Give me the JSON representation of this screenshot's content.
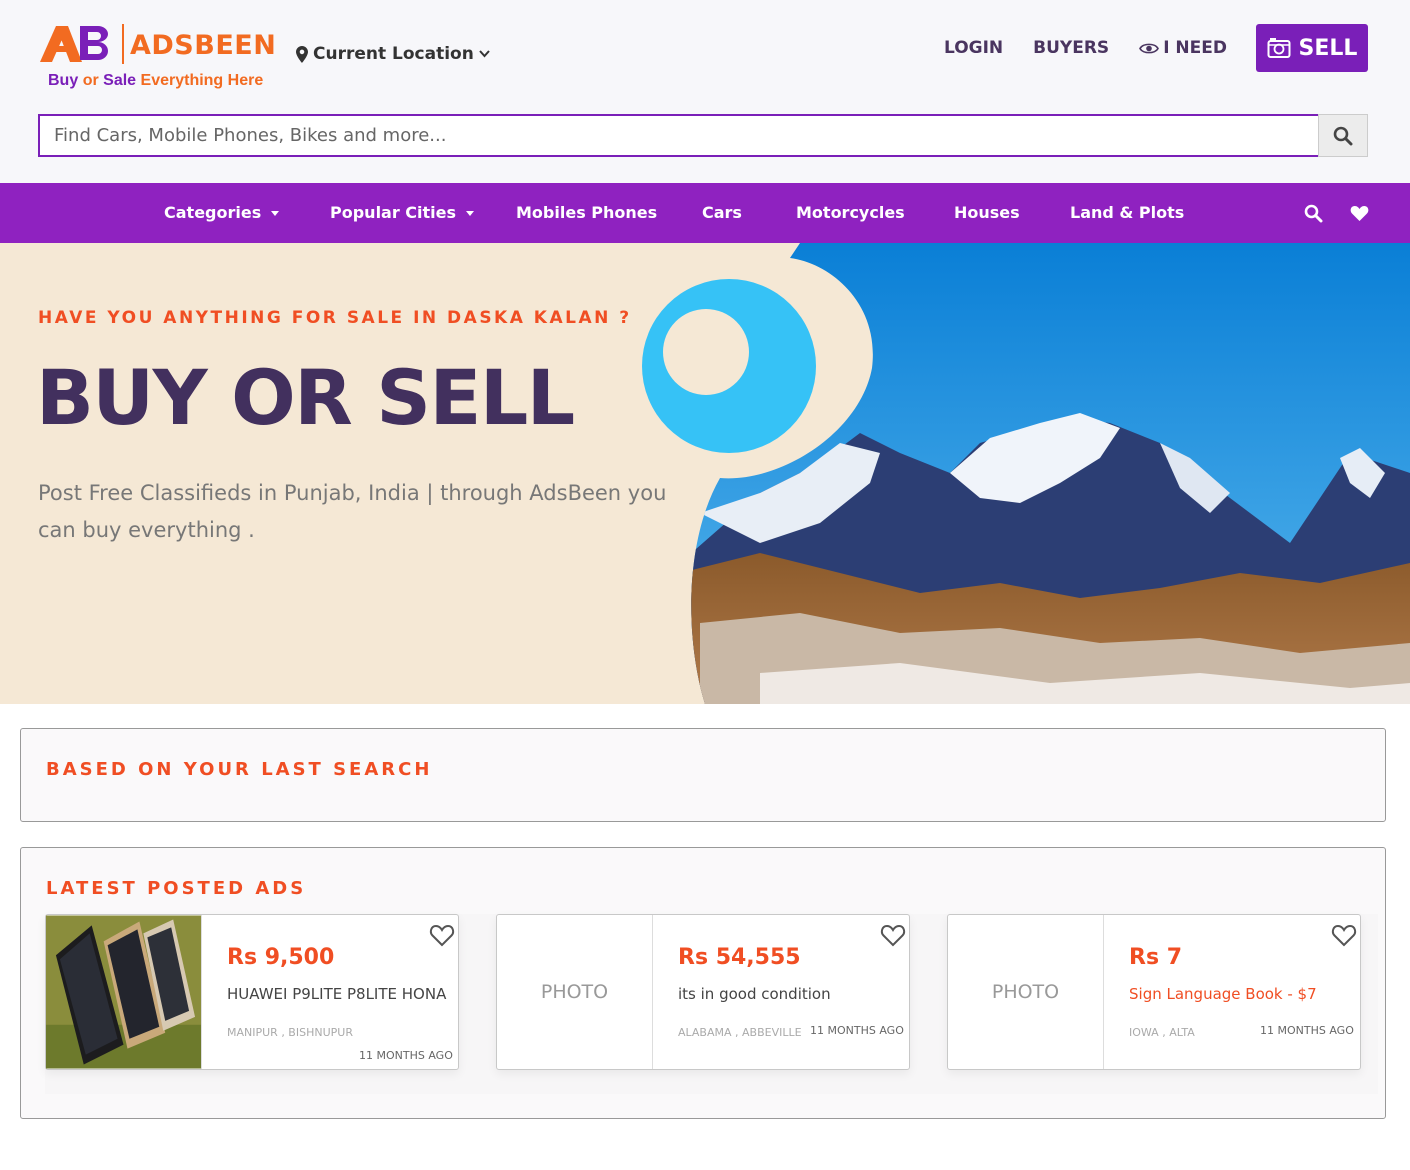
{
  "brand": {
    "name": "ADSBEEN",
    "tagline_part1": "Buy",
    "tagline_part2": "or",
    "tagline_part3": "Sale",
    "tagline_part4": "Everything Here",
    "primary_color": "#7a1fb8",
    "accent_color": "#f26b21"
  },
  "header": {
    "location_label": "Current Location",
    "location_icon": "map-marker-icon",
    "login": "LOGIN",
    "buyers": "BUYERS",
    "i_need": "I NEED",
    "sell": "SELL"
  },
  "search": {
    "placeholder": "Find Cars, Mobile Phones, Bikes and more...",
    "value": ""
  },
  "nav": {
    "items": [
      {
        "label": "Categories",
        "dropdown": true
      },
      {
        "label": "Popular Cities",
        "dropdown": true
      },
      {
        "label": "Mobiles Phones",
        "dropdown": false
      },
      {
        "label": "Cars",
        "dropdown": false
      },
      {
        "label": "Motorcycles",
        "dropdown": false
      },
      {
        "label": "Houses",
        "dropdown": false
      },
      {
        "label": "Land & Plots",
        "dropdown": false
      }
    ],
    "background": "#8f22c0"
  },
  "hero": {
    "eyebrow": "HAVE YOU ANYTHING FOR SALE IN DASKA KALAN ?",
    "title": "BUY OR SELL",
    "subtitle": "Post Free Classifieds in Punjab, India | through AdsBeen you can buy everything ."
  },
  "sections": {
    "last_search": "BASED ON YOUR LAST SEARCH",
    "latest": "LATEST POSTED ADS"
  },
  "ads": [
    {
      "price": "Rs 9,500",
      "title": "HUAWEI P9LITE P8LITE HONA",
      "location": "MANIPUR , BISHNUPUR",
      "time": "11 MONTHS AGO",
      "photo": ""
    },
    {
      "price": "Rs 54,555",
      "title": "its in good condition",
      "location": "ALABAMA , ABBEVILLE",
      "time": "11 MONTHS AGO",
      "photo": "PHOTO"
    },
    {
      "price": "Rs 7",
      "title": "Sign Language Book - $7",
      "location": "IOWA , ALTA",
      "time": "11 MONTHS AGO",
      "photo": "PHOTO"
    }
  ]
}
